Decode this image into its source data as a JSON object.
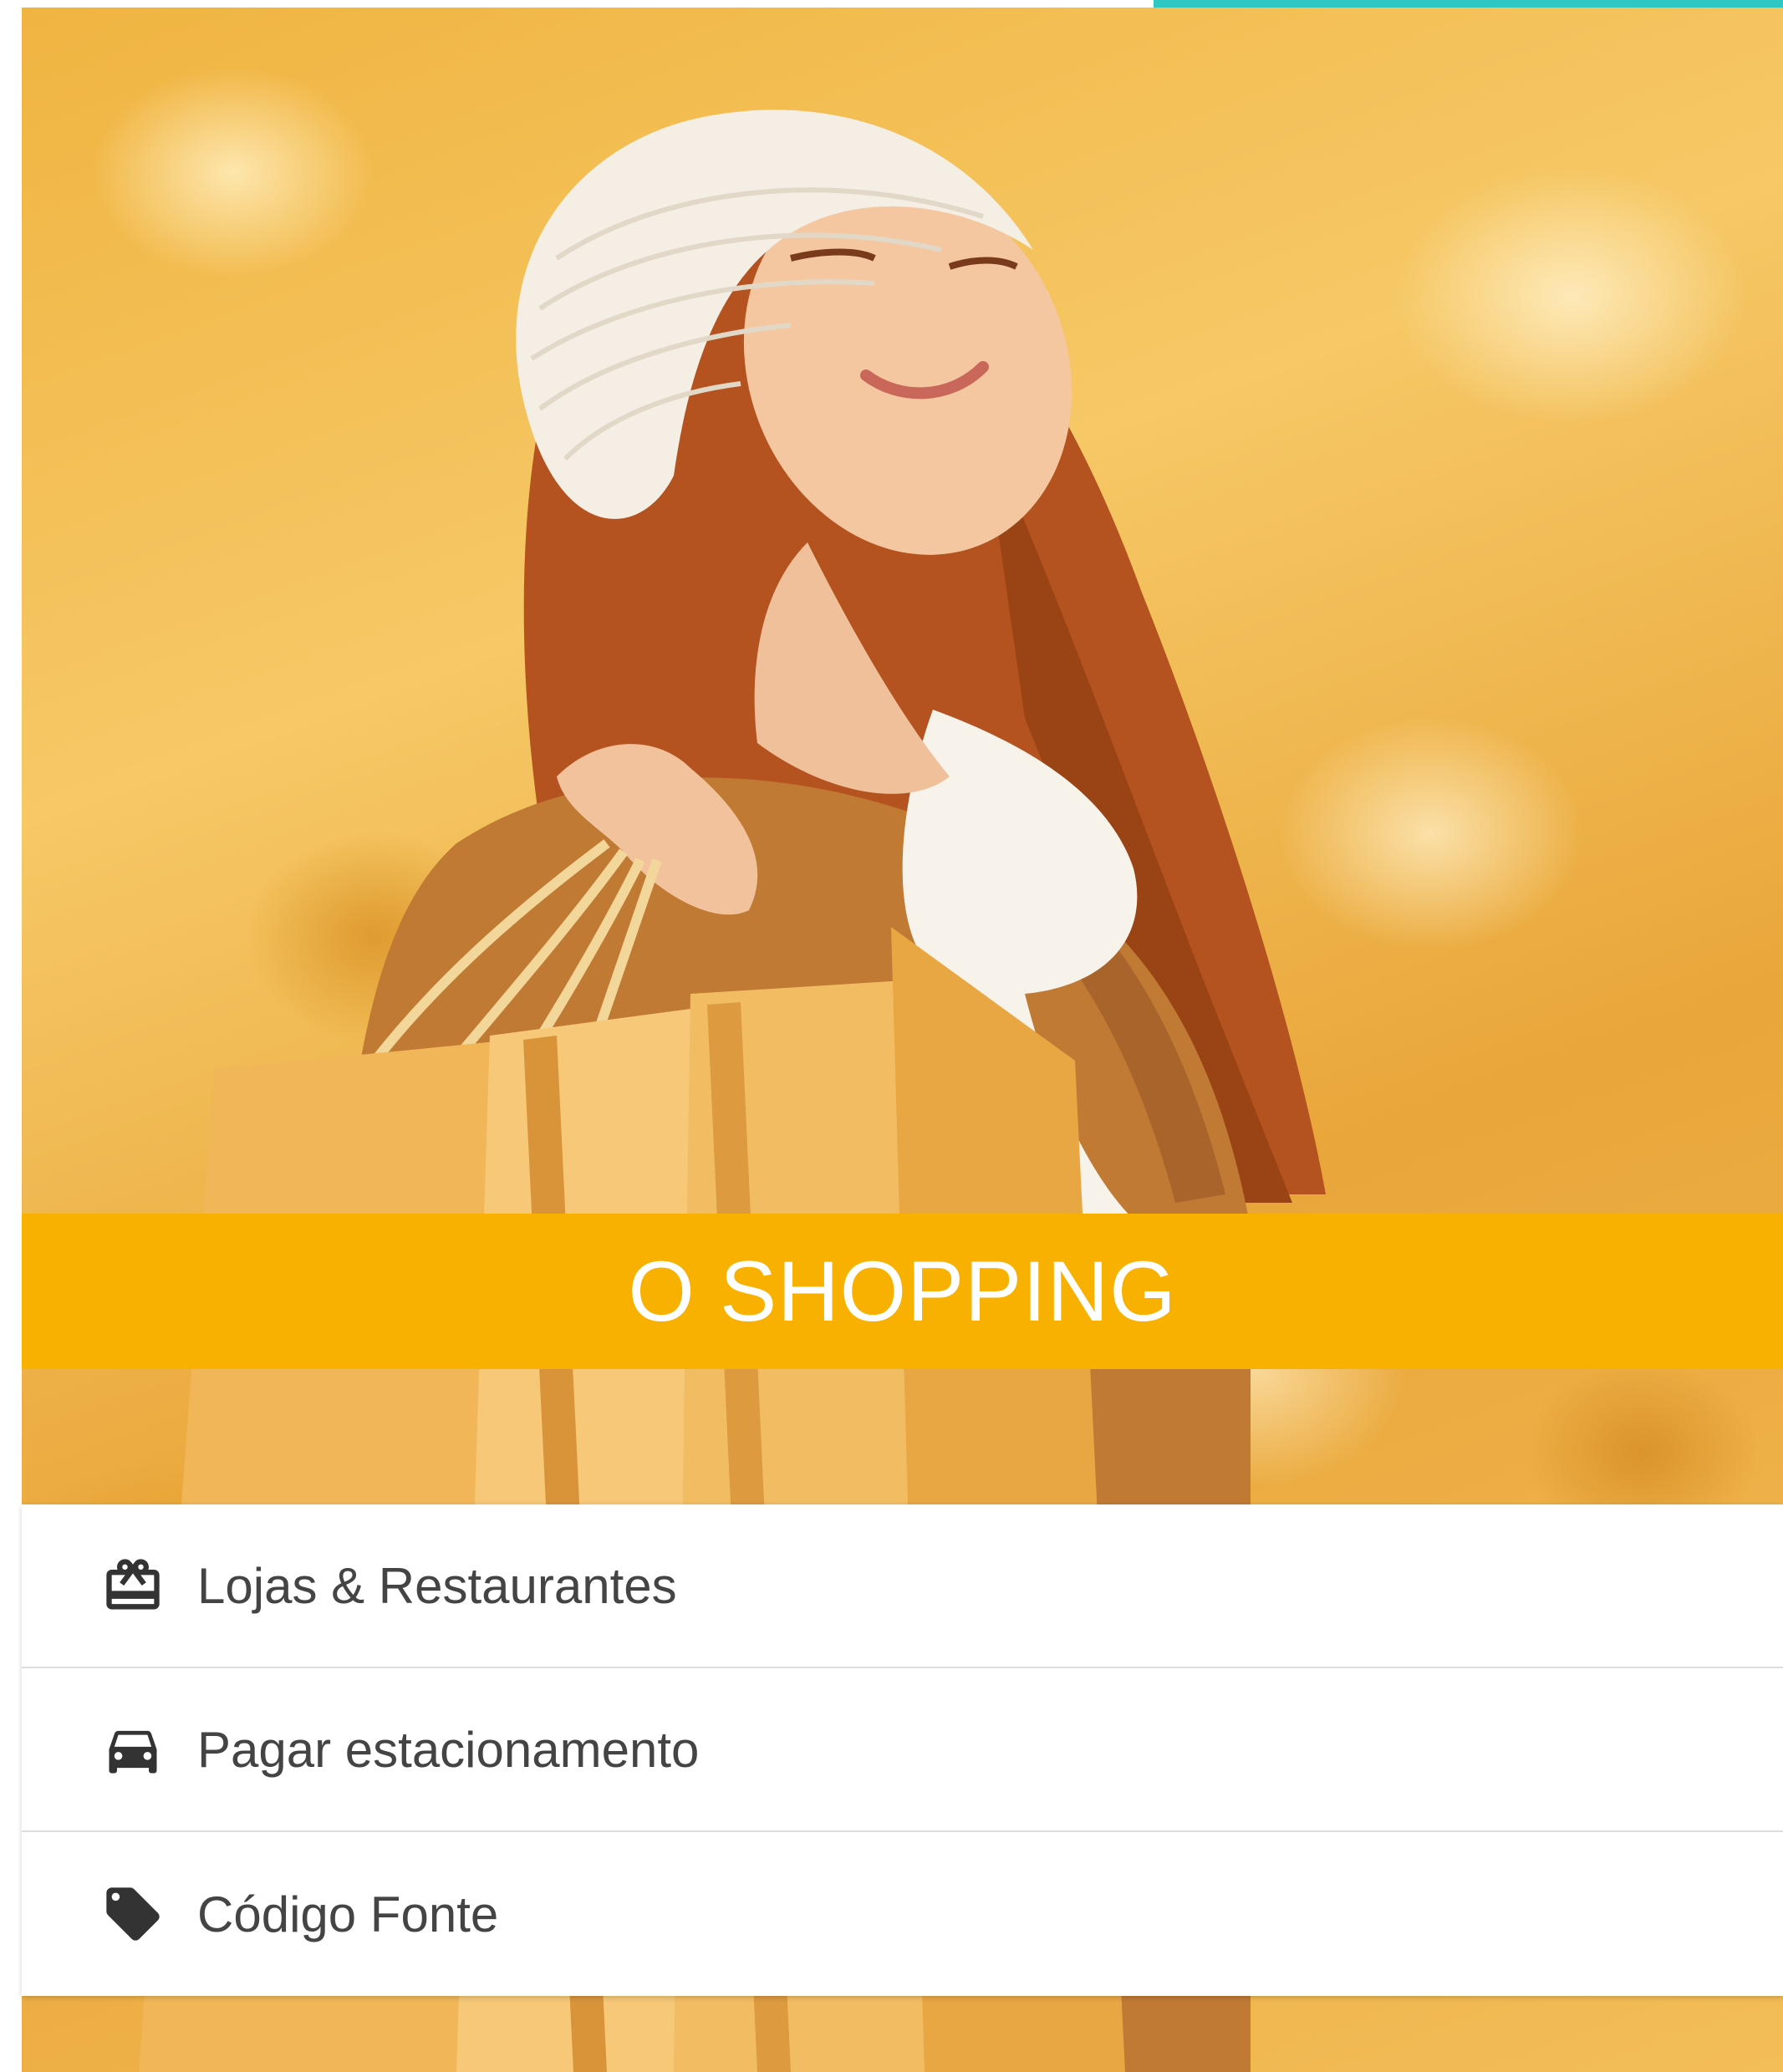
{
  "banner": {
    "title": "O SHOPPING",
    "color": "#f8b100"
  },
  "menu": {
    "items": [
      {
        "label": "Lojas & Restaurantes",
        "icon": "gift-card-icon"
      },
      {
        "label": "Pagar estacionamento",
        "icon": "car-icon"
      },
      {
        "label": "Código Fonte",
        "icon": "tag-icon"
      }
    ]
  },
  "colors": {
    "accent": "#2ec7c4",
    "text": "#444444"
  }
}
